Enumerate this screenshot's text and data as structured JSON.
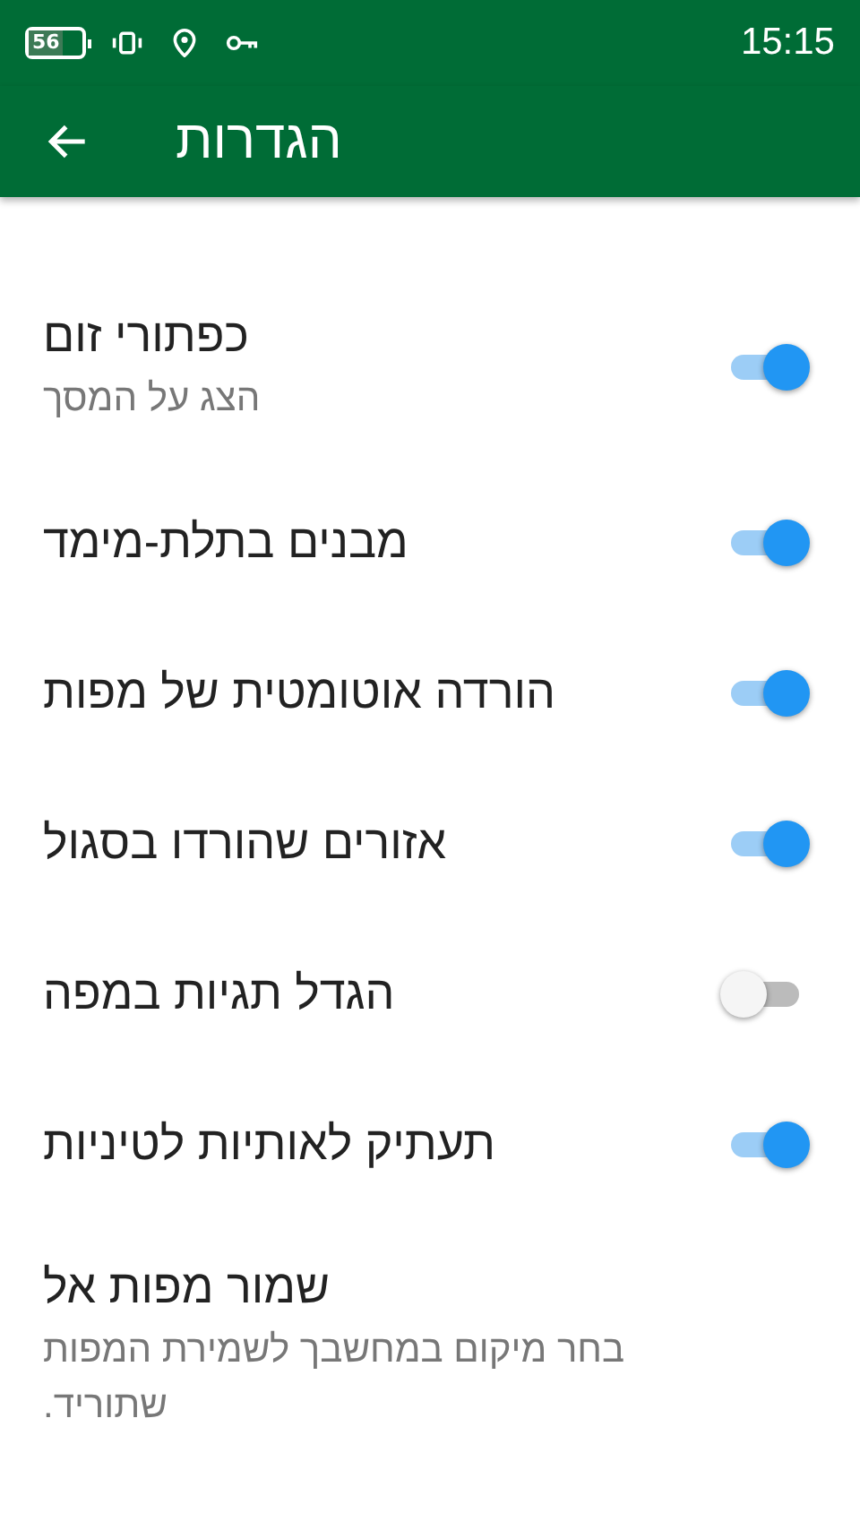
{
  "status_bar": {
    "battery": "56",
    "time": "15:15"
  },
  "app_bar": {
    "title": "הגדרות"
  },
  "settings": [
    {
      "title": "כפתורי זום",
      "subtitle": "הצג על המסך",
      "kind": "switch",
      "on": true
    },
    {
      "title": "מבנים בתלת-מימד",
      "kind": "switch",
      "on": true
    },
    {
      "title": "הורדה אוטומטית של מפות",
      "kind": "switch",
      "on": true
    },
    {
      "title": "אזורים שהורדו בסגול",
      "kind": "switch",
      "on": true
    },
    {
      "title": "הגדל תגיות במפה",
      "kind": "switch",
      "on": false
    },
    {
      "title": "תעתיק לאותיות לטיניות",
      "kind": "switch",
      "on": true
    },
    {
      "title": "שמור מפות אל",
      "subtitle": "בחר מיקום במחשבך לשמירת המפות שתוריד.",
      "kind": "link"
    }
  ]
}
